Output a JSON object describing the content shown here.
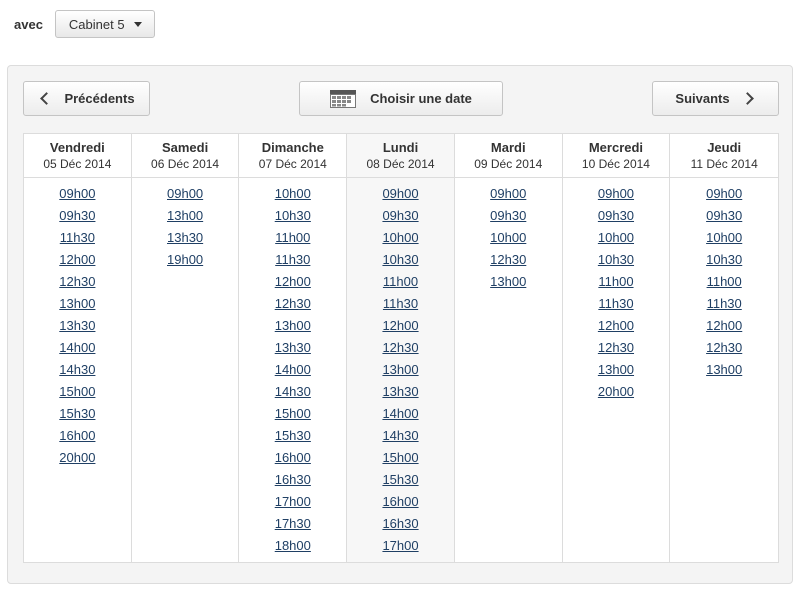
{
  "filter": {
    "label": "avec",
    "selected": "Cabinet 5"
  },
  "nav": {
    "prev_label": "Précédents",
    "choose_date_label": "Choisir une date",
    "next_label": "Suivants"
  },
  "days": [
    {
      "name": "Vendredi",
      "date": "05 Déc 2014",
      "slots": [
        "09h00",
        "09h30",
        "11h30",
        "12h00",
        "12h30",
        "13h00",
        "13h30",
        "14h00",
        "14h30",
        "15h00",
        "15h30",
        "16h00",
        "20h00"
      ]
    },
    {
      "name": "Samedi",
      "date": "06 Déc 2014",
      "slots": [
        "09h00",
        "13h00",
        "13h30",
        "19h00"
      ]
    },
    {
      "name": "Dimanche",
      "date": "07 Déc 2014",
      "slots": [
        "10h00",
        "10h30",
        "11h00",
        "11h30",
        "12h00",
        "12h30",
        "13h00",
        "13h30",
        "14h00",
        "14h30",
        "15h00",
        "15h30",
        "16h00",
        "16h30",
        "17h00",
        "17h30",
        "18h00"
      ]
    },
    {
      "name": "Lundi",
      "date": "08 Déc 2014",
      "slots": [
        "09h00",
        "09h30",
        "10h00",
        "10h30",
        "11h00",
        "11h30",
        "12h00",
        "12h30",
        "13h00",
        "13h30",
        "14h00",
        "14h30",
        "15h00",
        "15h30",
        "16h00",
        "16h30",
        "17h00"
      ]
    },
    {
      "name": "Mardi",
      "date": "09 Déc 2014",
      "slots": [
        "09h00",
        "09h30",
        "10h00",
        "12h30",
        "13h00"
      ]
    },
    {
      "name": "Mercredi",
      "date": "10 Déc 2014",
      "slots": [
        "09h00",
        "09h30",
        "10h00",
        "10h30",
        "11h00",
        "11h30",
        "12h00",
        "12h30",
        "13h00",
        "20h00"
      ]
    },
    {
      "name": "Jeudi",
      "date": "11 Déc 2014",
      "slots": [
        "09h00",
        "09h30",
        "10h00",
        "10h30",
        "11h00",
        "11h30",
        "12h00",
        "12h30",
        "13h00"
      ]
    }
  ]
}
